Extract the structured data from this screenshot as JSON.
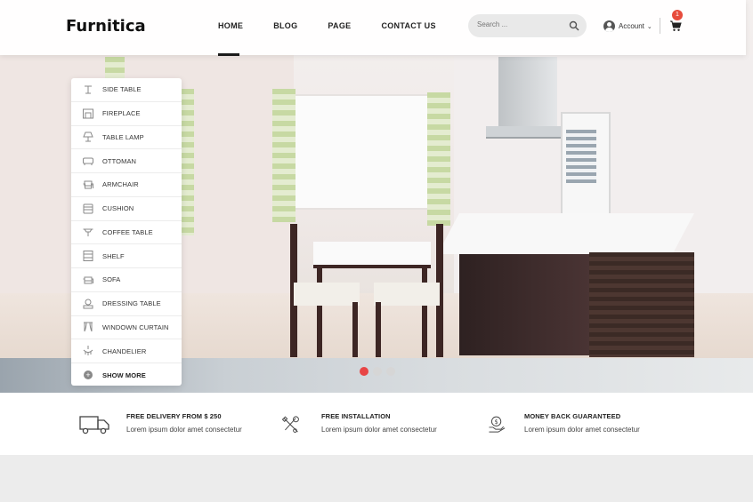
{
  "header": {
    "logo": "Furnitica",
    "nav": [
      {
        "label": "HOME",
        "active": true
      },
      {
        "label": "BLOG"
      },
      {
        "label": "PAGE"
      },
      {
        "label": "CONTACT US"
      }
    ],
    "search_placeholder": "Search ...",
    "account_label": "Account",
    "cart_count": "1"
  },
  "sidebar": {
    "items": [
      {
        "label": "SIDE TABLE",
        "icon": "side-table-icon"
      },
      {
        "label": "FIREPLACE",
        "icon": "fireplace-icon"
      },
      {
        "label": "TABLE LAMP",
        "icon": "table-lamp-icon"
      },
      {
        "label": "OTTOMAN",
        "icon": "ottoman-icon"
      },
      {
        "label": "ARMCHAIR",
        "icon": "armchair-icon"
      },
      {
        "label": "CUSHION",
        "icon": "cushion-icon"
      },
      {
        "label": "COFFEE TABLE",
        "icon": "coffee-table-icon"
      },
      {
        "label": "SHELF",
        "icon": "shelf-icon"
      },
      {
        "label": "SOFA",
        "icon": "sofa-icon"
      },
      {
        "label": "DRESSING TABLE",
        "icon": "dressing-table-icon"
      },
      {
        "label": "WINDOWN CURTAIN",
        "icon": "curtain-icon"
      },
      {
        "label": "CHANDELIER",
        "icon": "chandelier-icon"
      }
    ],
    "show_more": "SHOW MORE"
  },
  "slider": {
    "dots": 3,
    "active_index": 0
  },
  "features": [
    {
      "title": "FREE DELIVERY FROM $ 250",
      "desc": "Lorem ipsum dolor amet consectetur",
      "icon": "truck-icon"
    },
    {
      "title": "FREE INSTALLATION",
      "desc": "Lorem ipsum dolor amet consectetur",
      "icon": "tools-icon"
    },
    {
      "title": "MONEY BACK GUARANTEED",
      "desc": "Lorem ipsum dolor amet consectetur",
      "icon": "money-back-icon"
    }
  ],
  "colors": {
    "accent": "#e84545",
    "text": "#222222"
  }
}
